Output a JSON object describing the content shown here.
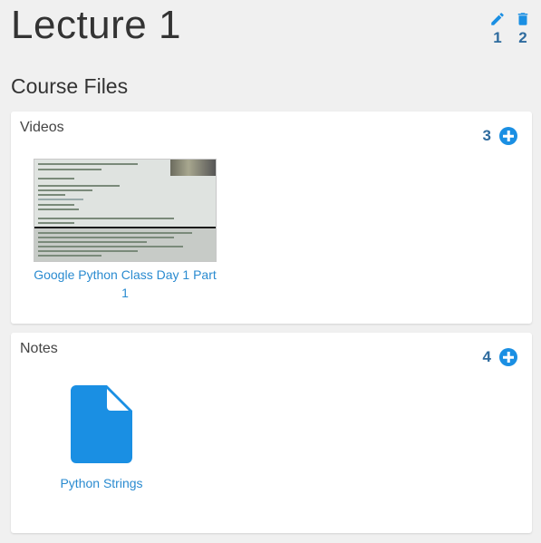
{
  "header": {
    "title": "Lecture 1",
    "edit_icon": "pencil-icon",
    "edit_number": "1",
    "delete_icon": "trash-icon",
    "delete_number": "2"
  },
  "section_title": "Course Files",
  "videos": {
    "title": "Videos",
    "add_number": "3",
    "add_icon": "plus-circle-icon",
    "items": [
      {
        "label": "Google Python Class Day 1 Part 1",
        "thumbnail": "video-thumbnail"
      }
    ]
  },
  "notes": {
    "title": "Notes",
    "add_number": "4",
    "add_icon": "plus-circle-icon",
    "items": [
      {
        "label": "Python Strings",
        "icon": "file-icon"
      }
    ]
  },
  "colors": {
    "accent": "#1a8fe3",
    "link": "#2a8bd0",
    "annotation": "#2e6b9e",
    "background": "#f0f0f0"
  }
}
